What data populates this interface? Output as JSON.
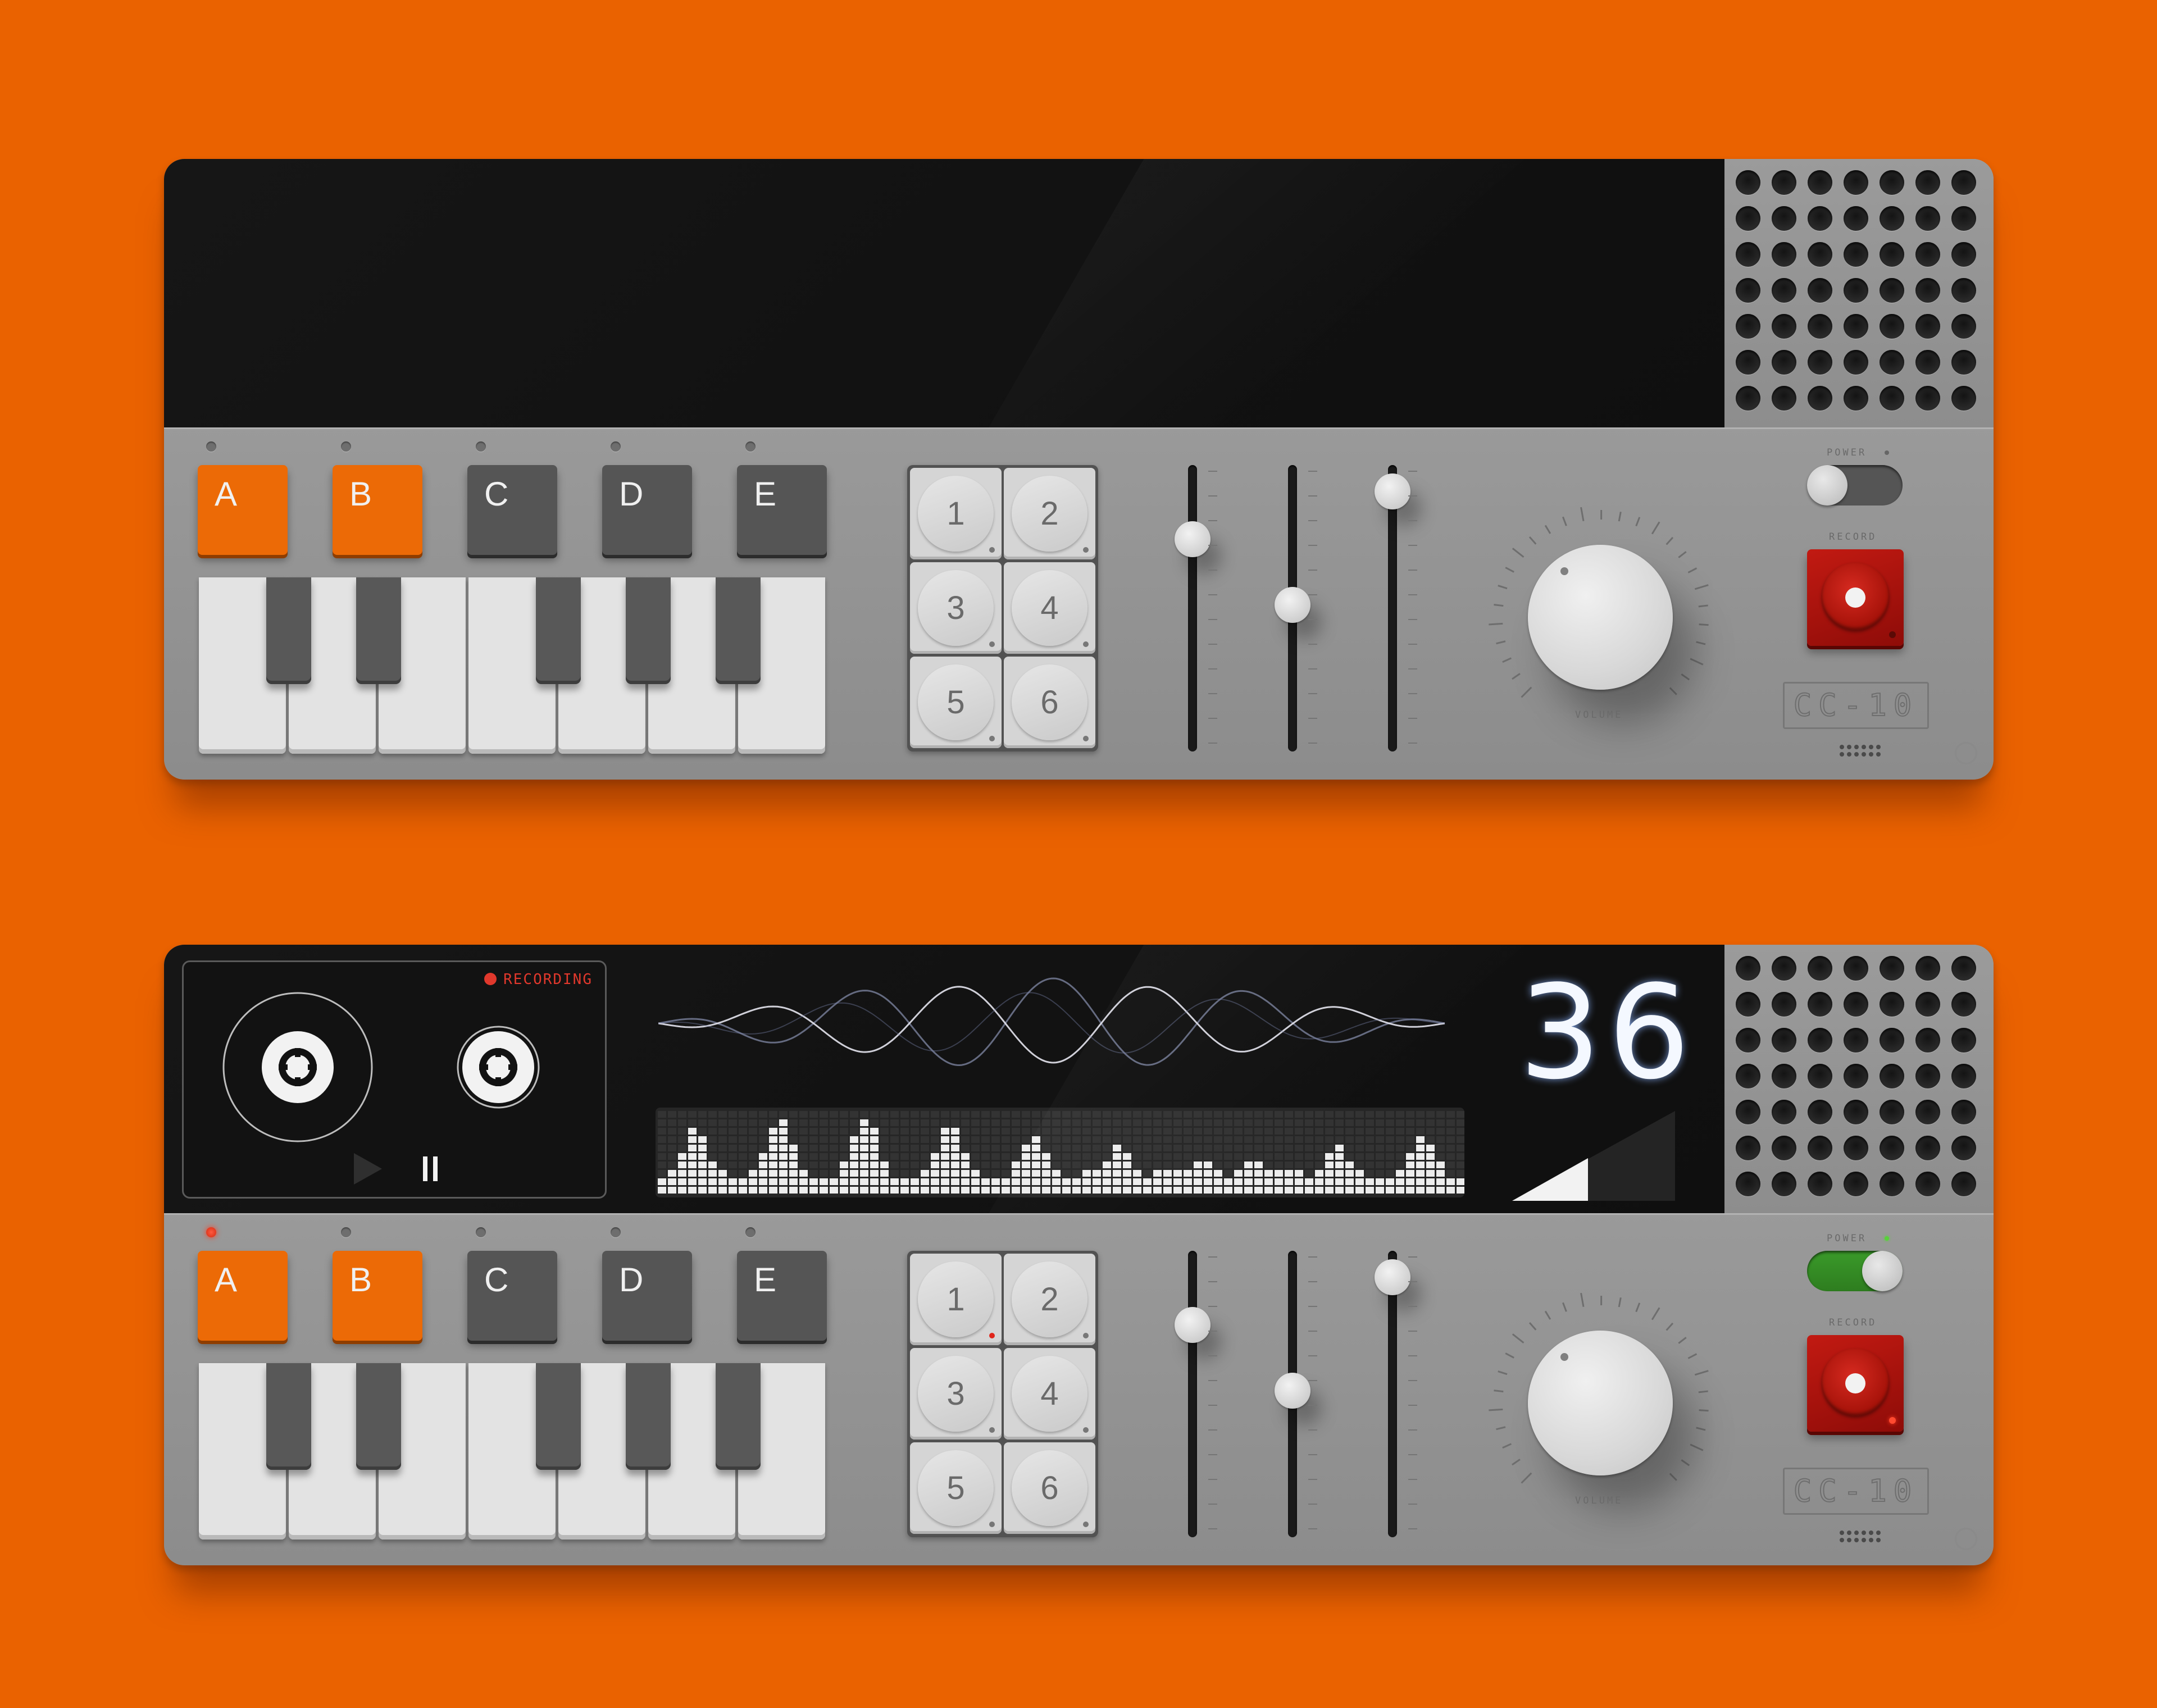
{
  "background_color": "#ea6200",
  "devices": [
    {
      "id": "unit-top",
      "screen_active": false,
      "track_keys": [
        {
          "label": "A",
          "selected": true,
          "led_on": false
        },
        {
          "label": "B",
          "selected": true,
          "led_on": false
        },
        {
          "label": "C",
          "selected": false,
          "led_on": false
        },
        {
          "label": "D",
          "selected": false,
          "led_on": false
        },
        {
          "label": "E",
          "selected": false,
          "led_on": false
        }
      ],
      "pads": [
        {
          "label": "1",
          "dot_active": false
        },
        {
          "label": "2",
          "dot_active": false
        },
        {
          "label": "3",
          "dot_active": false
        },
        {
          "label": "4",
          "dot_active": false
        },
        {
          "label": "5",
          "dot_active": false
        },
        {
          "label": "6",
          "dot_active": false
        }
      ],
      "faders": [
        {
          "level": 0.74
        },
        {
          "level": 0.5
        },
        {
          "level": 0.91
        }
      ],
      "power_label": "POWER",
      "power_on": false,
      "record_label": "RECORD",
      "record_active": false,
      "volume_label": "VOLUME",
      "model": "CC-10"
    },
    {
      "id": "unit-bottom",
      "screen_active": true,
      "track_keys": [
        {
          "label": "A",
          "selected": true,
          "led_on": true
        },
        {
          "label": "B",
          "selected": true,
          "led_on": false
        },
        {
          "label": "C",
          "selected": false,
          "led_on": false
        },
        {
          "label": "D",
          "selected": false,
          "led_on": false
        },
        {
          "label": "E",
          "selected": false,
          "led_on": false
        }
      ],
      "pads": [
        {
          "label": "1",
          "dot_active": true
        },
        {
          "label": "2",
          "dot_active": false
        },
        {
          "label": "3",
          "dot_active": false
        },
        {
          "label": "4",
          "dot_active": false
        },
        {
          "label": "5",
          "dot_active": false
        },
        {
          "label": "6",
          "dot_active": false
        }
      ],
      "faders": [
        {
          "level": 0.74
        },
        {
          "level": 0.5
        },
        {
          "level": 0.91
        }
      ],
      "power_label": "POWER",
      "power_on": true,
      "record_label": "RECORD",
      "record_active": true,
      "volume_label": "VOLUME",
      "model": "CC-10",
      "display": {
        "recording_label": "RECORDING",
        "bpm": "36",
        "icons": [
          "tape-reel-icon",
          "play-icon",
          "pause-icon"
        ]
      }
    }
  ]
}
